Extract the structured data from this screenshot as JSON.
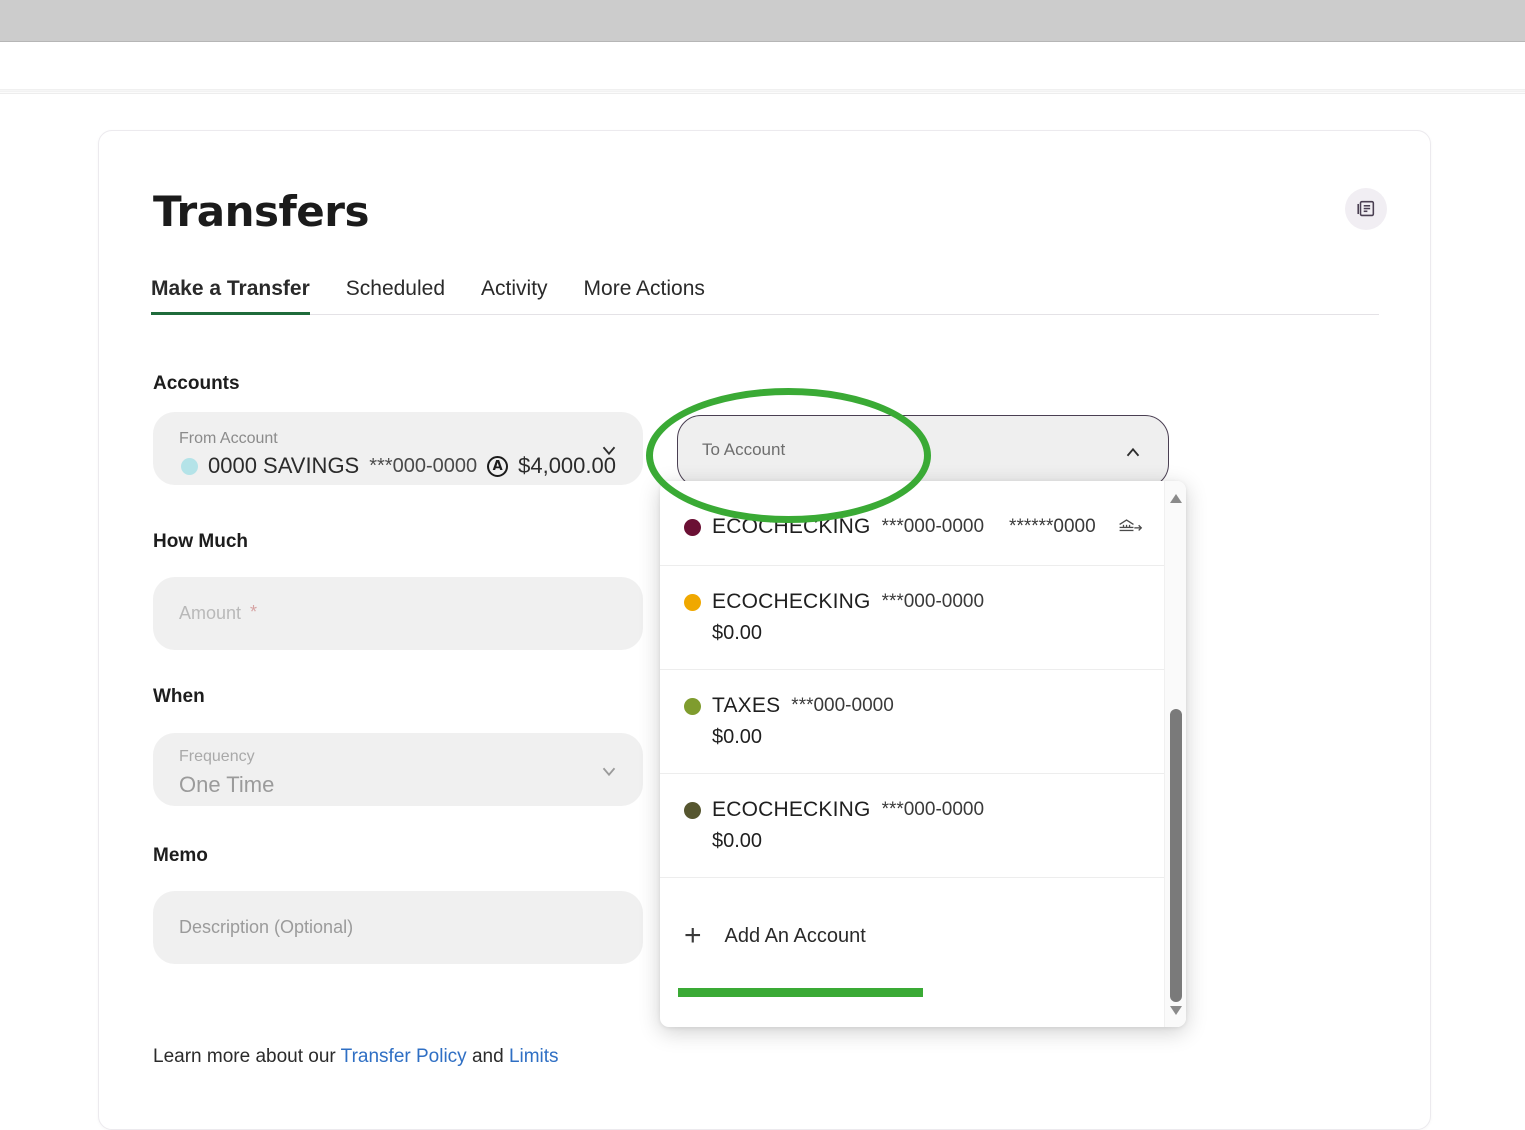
{
  "page": {
    "title": "Transfers"
  },
  "header": {
    "doc_icon": "document-list-icon"
  },
  "tabs": [
    {
      "label": "Make a Transfer",
      "active": true
    },
    {
      "label": "Scheduled",
      "active": false
    },
    {
      "label": "Activity",
      "active": false
    },
    {
      "label": "More Actions",
      "active": false
    }
  ],
  "sections": {
    "accounts_label": "Accounts",
    "how_much_label": "How Much",
    "when_label": "When",
    "memo_label": "Memo"
  },
  "from_account": {
    "field_label": "From Account",
    "dot_color": "#b4e3e8",
    "name": "0000 SAVINGS",
    "mask": "***000-0000",
    "badge": "A",
    "balance": "$4,000.00",
    "chevron": "chevron-down-icon"
  },
  "to_account": {
    "placeholder": "To Account",
    "value": "",
    "chevron": "chevron-up-icon",
    "expanded": true
  },
  "amount": {
    "placeholder": "Amount",
    "required_marker": "*",
    "value": ""
  },
  "frequency": {
    "field_label": "Frequency",
    "value": "One Time",
    "chevron": "chevron-down-icon"
  },
  "memo": {
    "placeholder": "Description (Optional)",
    "value": ""
  },
  "dropdown": {
    "items": [
      {
        "dot_color": "#6b1034",
        "name": "ECOCHECKING",
        "mask": "***000-0000",
        "external_mask": "******0000",
        "amount": "",
        "icon": "bank-transfer-icon"
      },
      {
        "dot_color": "#f0a800",
        "name": "ECOCHECKING",
        "mask": "***000-0000",
        "external_mask": "",
        "amount": "$0.00",
        "icon": ""
      },
      {
        "dot_color": "#7f9c2e",
        "name": "TAXES",
        "mask": "***000-0000",
        "external_mask": "",
        "amount": "$0.00",
        "icon": ""
      },
      {
        "dot_color": "#56562f",
        "name": "ECOCHECKING",
        "mask": "***000-0000",
        "external_mask": "",
        "amount": "$0.00",
        "icon": ""
      }
    ],
    "add_account_label": "Add An Account",
    "add_icon": "plus-icon",
    "scroll_up_icon": "scroll-up-arrow-icon",
    "scroll_down_icon": "scroll-down-arrow-icon"
  },
  "footer": {
    "prefix": "Learn more about our ",
    "link1": "Transfer Policy",
    "middle": " and ",
    "link2": "Limits"
  },
  "annotations": {
    "highlight_color": "#3aaa35",
    "ellipse_target": "to-account-field",
    "underline_target": "add-an-account-row"
  }
}
